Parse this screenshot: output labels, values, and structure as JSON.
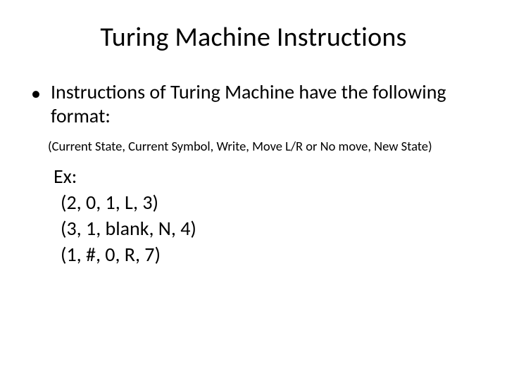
{
  "title": "Turing Machine Instructions",
  "bullet": {
    "marker": "•",
    "text": "Instructions of Turing Machine have the following format:"
  },
  "format_line": "(Current State, Current Symbol, Write, Move L/R or No move, New State)",
  "example": {
    "label": "Ex:",
    "tuples": [
      "(2, 0, 1, L, 3)",
      "(3, 1, blank, N, 4)",
      "(1, #, 0, R, 7)"
    ]
  }
}
